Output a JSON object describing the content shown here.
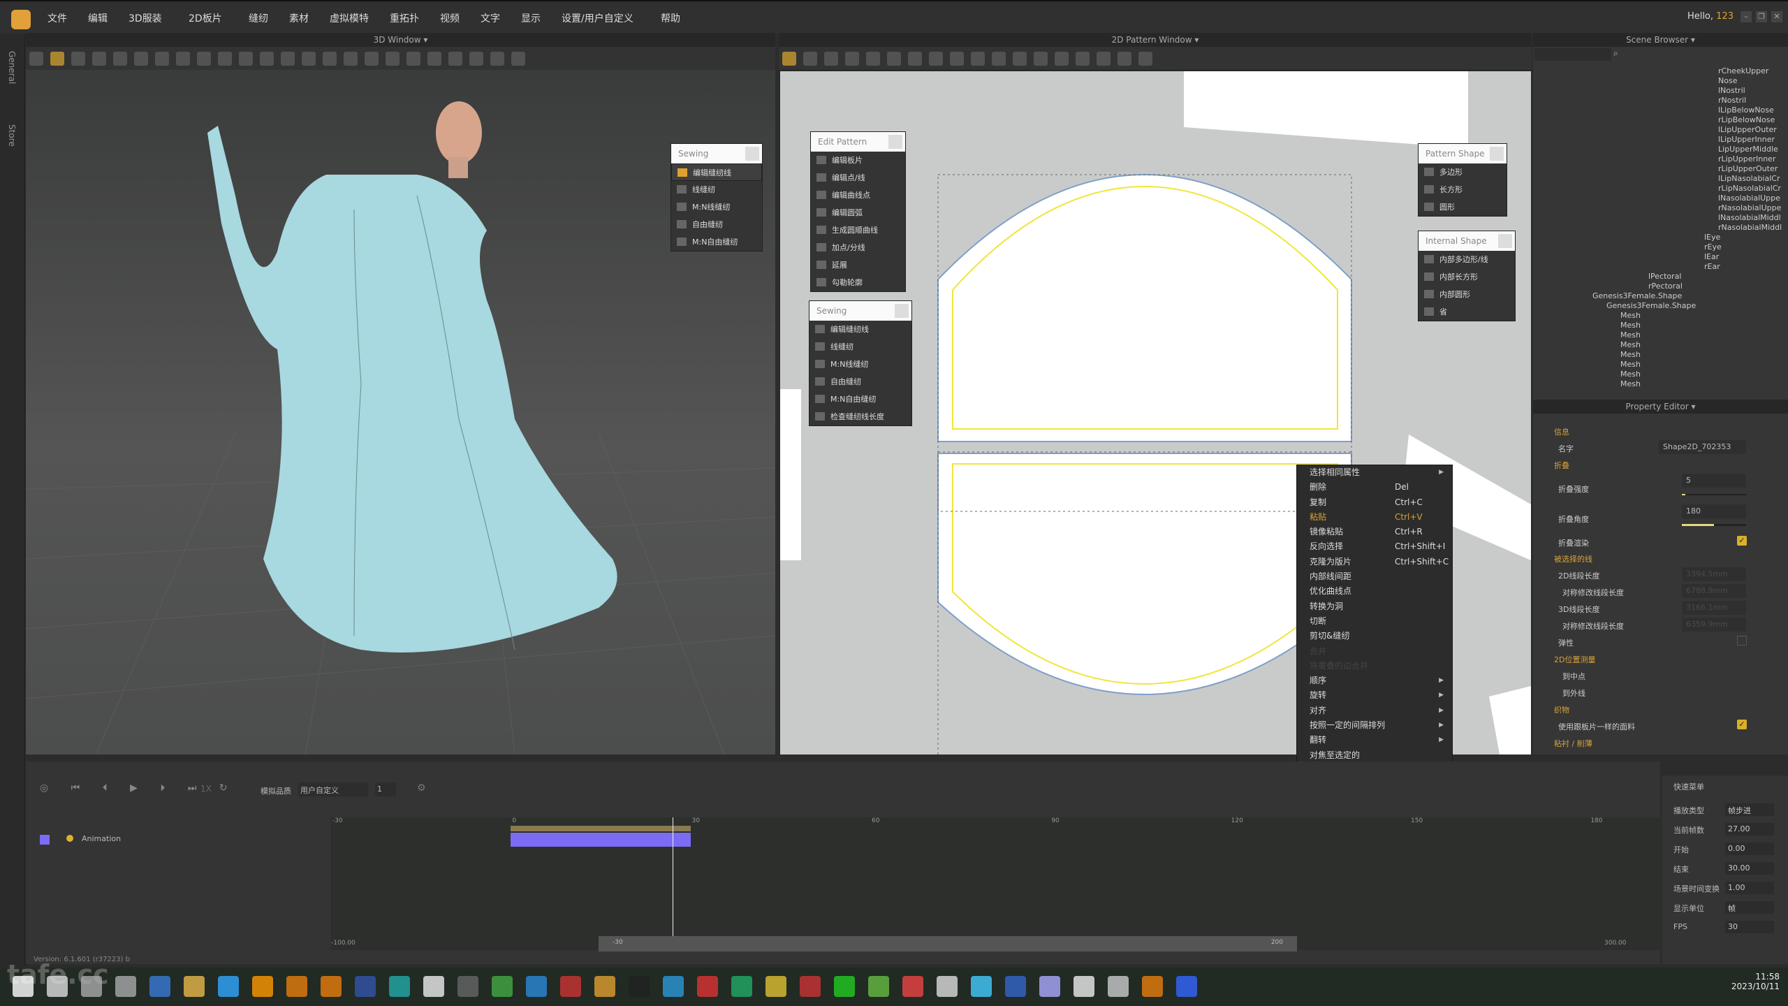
{
  "app": {
    "menu": [
      "文件",
      "编辑",
      "3D服装",
      "2D板片",
      "缝纫",
      "素材",
      "虚拟模特",
      "重拓扑",
      "视频",
      "文字",
      "显示",
      "设置/用户自定义",
      "帮助"
    ],
    "greeting": "Hello,",
    "user": "123"
  },
  "sidebar": {
    "tabs": [
      "General",
      "Store"
    ]
  },
  "window3d": {
    "title": "3D Window",
    "sewing_panel": {
      "title": "Sewing",
      "items": [
        "编辑缝纫线",
        "线缝纫",
        "M:N线缝纫",
        "自由缝纫",
        "M:N自由缝纫"
      ]
    }
  },
  "window2d": {
    "title": "2D Pattern Window",
    "edit_pattern": {
      "title": "Edit Pattern",
      "items": [
        "编辑板片",
        "编辑点/线",
        "编辑曲线点",
        "编辑圆弧",
        "生成圆顺曲线",
        "加点/分线",
        "延展",
        "勾勒轮廓"
      ]
    },
    "sewing": {
      "title": "Sewing",
      "items": [
        "编辑缝纫线",
        "线缝纫",
        "M:N线缝纫",
        "自由缝纫",
        "M:N自由缝纫",
        "检查缝纫线长度"
      ]
    },
    "pattern_shape": {
      "title": "Pattern Shape",
      "items": [
        "多边形",
        "长方形",
        "圆形"
      ]
    },
    "internal_shape": {
      "title": "Internal Shape",
      "items": [
        "内部多边形/线",
        "内部长方形",
        "内部圆形",
        "省"
      ]
    },
    "context_menu": [
      {
        "label": "选择相同属性",
        "submenu": true
      },
      {
        "label": "删除",
        "shortcut": "Del"
      },
      {
        "label": "复制",
        "shortcut": "Ctrl+C"
      },
      {
        "label": "粘贴",
        "shortcut": "Ctrl+V",
        "hover": true
      },
      {
        "label": "镜像粘贴",
        "shortcut": "Ctrl+R"
      },
      {
        "label": "反向选择",
        "shortcut": "Ctrl+Shift+I"
      },
      {
        "label": "克隆为版片",
        "shortcut": "Ctrl+Shift+C"
      },
      {
        "label": "内部线间距"
      },
      {
        "label": "优化曲线点"
      },
      {
        "label": "转换为洞"
      },
      {
        "label": "切断"
      },
      {
        "label": "剪切&缝纫"
      },
      {
        "label": "合并",
        "disabled": true
      },
      {
        "label": "将重叠的边合并",
        "disabled": true
      },
      {
        "label": "顺序",
        "submenu": true
      },
      {
        "label": "旋转",
        "submenu": true
      },
      {
        "label": "对齐",
        "submenu": true
      },
      {
        "label": "按照一定的间隔排列",
        "submenu": true
      },
      {
        "label": "翻转",
        "submenu": true
      },
      {
        "label": "对焦至选定的"
      }
    ]
  },
  "scene_browser": {
    "title": "Scene Browser",
    "nodes_deep": [
      "rCheekUpper",
      "Nose",
      "lNostril",
      "rNostril",
      "lLipBelowNose",
      "rLipBelowNose",
      "lLipUpperOuter",
      "lLipUpperInner",
      "LipUpperMiddle",
      "rLipUpperInner",
      "rLipUpperOuter",
      "lLipNasolabialCr",
      "rLipNasolabialCr",
      "lNasolabialUppe",
      "rNasolabialUppe",
      "lNasolabialMiddl",
      "rNasolabialMiddl"
    ],
    "nodes_mid": [
      "lEye",
      "rEye",
      "lEar",
      "rEar"
    ],
    "nodes_chest": [
      "lPectoral",
      "rPectoral"
    ],
    "shape1": "Genesis3Female.Shape",
    "shape2": "Genesis3Female.Shape",
    "meshes": [
      "Mesh",
      "Mesh",
      "Mesh",
      "Mesh",
      "Mesh",
      "Mesh",
      "Mesh",
      "Mesh"
    ]
  },
  "property_editor": {
    "title": "Property Editor",
    "info": {
      "label": "信息",
      "name_label": "名字",
      "name_value": "Shape2D_702353"
    },
    "fold": {
      "label": "折叠",
      "strength_label": "折叠强度",
      "strength_value": "5",
      "strength_fraction": 0.05,
      "angle_label": "折叠角度",
      "angle_value": "180",
      "angle_fraction": 0.5,
      "render_label": "折叠渲染",
      "render_checked": true
    },
    "selected_line": {
      "label": "被选择的线",
      "len2d_label": "2D线段长度",
      "len2d": "3394.5mm",
      "sym2d_label": "对称修改线段长度",
      "sym2d": "6788.9mm",
      "len3d_label": "3D线段长度",
      "len3d": "3166.1mm",
      "sym3d_label": "对称修改线段长度",
      "sym3d": "6359.9mm",
      "elastic_label": "弹性",
      "elastic_checked": false
    },
    "measure": {
      "label": "2D位置测量",
      "to_mid": "到中点",
      "to_outer": "到外线"
    },
    "fabric": {
      "label": "织物",
      "same_label": "使用跟板片一样的面料",
      "same_checked": true
    },
    "adhesive": {
      "label": "粘衬 / 削薄"
    }
  },
  "timeline": {
    "quality_label": "模拟品质",
    "quality_value": "用户自定义",
    "step_value": "1",
    "speed": "1X",
    "track": "Animation",
    "ticks": [
      "-30",
      "0",
      "30",
      "60",
      "90",
      "120",
      "150",
      "180"
    ],
    "range_start": "-100.00",
    "range_end": "300.00",
    "scroll_start": "-30",
    "scroll_end": "200",
    "version_label": "Version:",
    "version": "6.1.601 (r37223)",
    "version_suffix": "b",
    "current_frame": 27,
    "anim_end": 30
  },
  "quick_menu": {
    "title": "快速菜单",
    "rows": [
      {
        "label": "播放类型",
        "value": "帧步进"
      },
      {
        "label": "当前帧数",
        "value": "27.00"
      },
      {
        "label": "开始",
        "value": "0.00"
      },
      {
        "label": "结束",
        "value": "30.00"
      },
      {
        "label": "场景时间变换",
        "value": "1.00"
      },
      {
        "label": "显示单位",
        "value": "帧"
      },
      {
        "label": "FPS",
        "value": "30"
      }
    ]
  },
  "taskbar": {
    "time": "11:58",
    "date": "2023/10/11",
    "watermark": "tafe.cc"
  },
  "colors": {
    "accent": "#d9a23a",
    "dress": "#a8d8e0",
    "track": "#7b6cf5",
    "seam": "#f0e63a"
  }
}
